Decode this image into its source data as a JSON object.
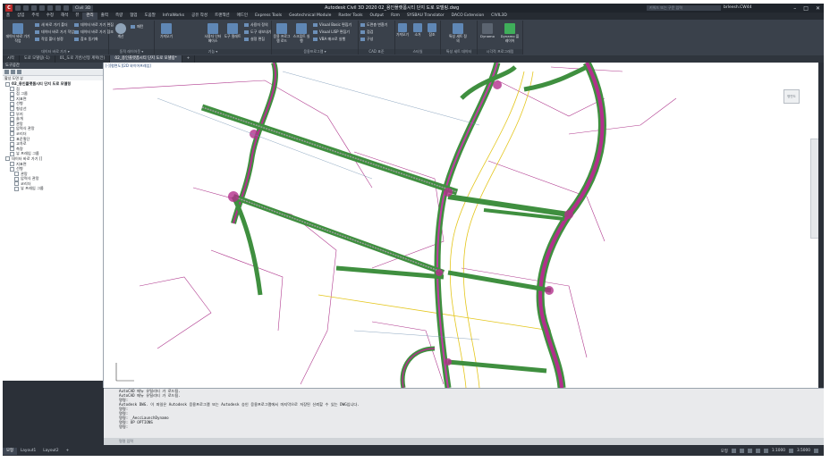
{
  "titlebar": {
    "logo": "C",
    "workspace": "Civil 3D",
    "title": "Autodesk Civil 3D 2020   02_용인플랫폼시티 단지 도로 모델링.dwg",
    "search_placeholder": "키워드 또는 구문 입력",
    "user": "brleesh.CW44",
    "min": "–",
    "max": "□",
    "close": "✕"
  },
  "ribbon_tabs": [
    "홈",
    "삽입",
    "주석",
    "수정",
    "해석",
    "뷰",
    "관리",
    "출력",
    "측량",
    "협업",
    "도움말",
    "InfraWorks",
    "공유 작성",
    "트랜잭션",
    "애드인",
    "Express Tools",
    "Geotechnical Module",
    "Raster Tools",
    "Output",
    "Rzm",
    "SYSBAU Translator",
    "DACO Extension",
    "CIVIL3D"
  ],
  "ribbon_active_tab": "관리",
  "ribbon": {
    "panel1": {
      "title": "데이터 바로 가기 ▾",
      "big": "데이터 바로 가기 작업",
      "items": [
        "새 바로 가기 폴더",
        "데이터 바로 가기 작업",
        "작업 폴더 설정",
        "데이터 바로 가기 편집",
        "데이터 바로 가기 참조",
        "참조 동기화"
      ]
    },
    "panel2": {
      "title": "동적 레이아웃 ▾",
      "items": [
        "계산",
        "패턴"
      ]
    },
    "panel3": {
      "title": "기능 ▾",
      "big": "가져오기",
      "items": [
        "사용자 인터페이스",
        "도구 팔레트",
        "사용자 정의",
        "도구 내보내기",
        "설정 편집",
        "데이터 내보내기"
      ]
    },
    "panel4": {
      "title": "응용프로그램 ▾",
      "items": [
        "응용 프로그램 로드",
        "스크립트 실행",
        "Visual Basic 편집기",
        "Visual LISP 편집기",
        "VBA 매크로 실행"
      ]
    },
    "panel5": {
      "title": "CAD 표준",
      "items": [
        "도면층 변환기",
        "점검",
        "구성"
      ]
    },
    "panel6": {
      "title": "스타일",
      "items": [
        "가져오기",
        "소거",
        "참조"
      ]
    },
    "panel7": {
      "title": "특성 세트 데이터",
      "items": [
        "특성 세트 정의"
      ]
    },
    "panel8": {
      "title": "시각적 프로그래밍",
      "items": [
        "Dynamo",
        "Dynamo 플레이어"
      ]
    }
  },
  "doc_tabs": [
    "시작",
    "도로 모델링(-1)",
    "01_도로 기반/선형 계획(안)",
    "02_용인플랫폼시티 단지 도로 모델링*",
    "+"
  ],
  "doc_active": 3,
  "toolspace": {
    "header": "도구공간",
    "title": "활성 도면 뷰",
    "tree": [
      {
        "label": "02_용인플랫폼시티 단지 도로 모델링",
        "level": 0,
        "bold": true
      },
      {
        "label": "점",
        "level": 1
      },
      {
        "label": "점 그룹",
        "level": 1
      },
      {
        "label": "지표면",
        "level": 1
      },
      {
        "label": "선형",
        "level": 1
      },
      {
        "label": "형상선",
        "level": 1
      },
      {
        "label": "부지",
        "level": 1
      },
      {
        "label": "솔개",
        "level": 1
      },
      {
        "label": "관망",
        "level": 1
      },
      {
        "label": "압력식 관망",
        "level": 1
      },
      {
        "label": "코리더",
        "level": 1
      },
      {
        "label": "표준횡단",
        "level": 1
      },
      {
        "label": "교차로",
        "level": 1
      },
      {
        "label": "측량",
        "level": 1
      },
      {
        "label": "뷰 프레임 그룹",
        "level": 1
      },
      {
        "label": "데이터 바로 가기 []",
        "level": 0
      },
      {
        "label": "지표면",
        "level": 1
      },
      {
        "label": "선형",
        "level": 1
      },
      {
        "label": "관망",
        "level": 2
      },
      {
        "label": "압력식 관망",
        "level": 2
      },
      {
        "label": "코리더",
        "level": 2
      },
      {
        "label": "뷰 프레임 그룹",
        "level": 2
      }
    ]
  },
  "drawing": {
    "view_label": "[-][평면도][2D 와이어프레임]"
  },
  "navcube": {
    "label": "평면도",
    "north": "N",
    "west": "W"
  },
  "command": {
    "lines": [
      "AutoCAD 메뉴 유틸리티 가 로드됨.",
      "AutoCAD 메뉴 유틸리티 가 로드됨.",
      "명령:",
      "Autodesk DWG.  이 파일은 Autodesk 응용프로그램 또는 Autodesk 승인 응용프로그램에서 마지막으로 저장된 신뢰할 수 있는 DWG입니다.",
      "명령:",
      "명령:",
      "명령: _AeccLaunchDynamo",
      "명령: OP OPTIONS",
      "명령:"
    ],
    "placeholder": "명령 입력"
  },
  "status": {
    "tabs": [
      "모형",
      "Layout1",
      "Layout2",
      "+"
    ],
    "active": 0,
    "model": "모형",
    "scale": "1:1000",
    "value": "3.5000"
  }
}
